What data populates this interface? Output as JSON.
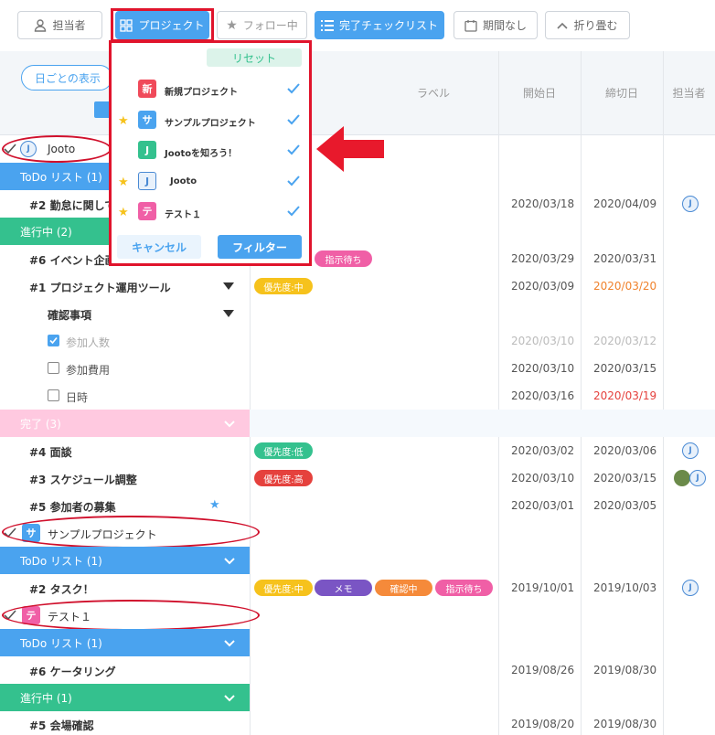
{
  "toolbar": {
    "assignee": "担当者",
    "project": "プロジェクト",
    "following": "フォロー中",
    "checklist": "完了チェックリスト",
    "no_deadline": "期間なし",
    "collapse": "折り畳む"
  },
  "left_header": {
    "view_by_day": "日ごとの表示"
  },
  "columns": {
    "label": "ラベル",
    "start": "開始日",
    "end": "締切日",
    "assignee": "担当者"
  },
  "dropdown": {
    "reset": "リセット",
    "cancel": "キャンセル",
    "filter": "フィルター",
    "items": [
      {
        "badge": "新",
        "name": "新規プロジェクト",
        "star": false
      },
      {
        "badge": "サ",
        "name": "サンプルプロジェクト",
        "star": true
      },
      {
        "badge": "J",
        "name": "Jootoを知ろう！",
        "star": false
      },
      {
        "badge": "J",
        "name": "Jooto",
        "star": true
      },
      {
        "badge": "テ",
        "name": "テスト１",
        "star": true
      }
    ]
  },
  "rows": {
    "proj_jooto": "Jooto",
    "todo1": "ToDo リスト (1)",
    "task_2a": "#2 勤怠に関して",
    "task_2a_start": "2020/03/18",
    "task_2a_end": "2020/04/09",
    "inprog": "進行中 (2)",
    "task_6": "#6 イベント企画",
    "task_6_tag": "指示待ち",
    "task_6_start": "2020/03/29",
    "task_6_end": "2020/03/31",
    "task_1": "#1 プロジェクト運用ツール",
    "task_1_tag": "優先度:中",
    "task_1_start": "2020/03/09",
    "task_1_end": "2020/03/20",
    "confirm": "確認事項",
    "sub_people": "参加人数",
    "sub_people_start": "2020/03/10",
    "sub_people_end": "2020/03/12",
    "sub_cost": "参加費用",
    "sub_cost_start": "2020/03/10",
    "sub_cost_end": "2020/03/15",
    "sub_date": "日時",
    "sub_date_start": "2020/03/16",
    "sub_date_end": "2020/03/19",
    "done": "完了 (3)",
    "task_4": "#4 面談",
    "task_4_tag": "優先度:低",
    "task_4_start": "2020/03/02",
    "task_4_end": "2020/03/06",
    "task_3": "#3 スケジュール調整",
    "task_3_tag": "優先度:高",
    "task_3_start": "2020/03/10",
    "task_3_end": "2020/03/15",
    "task_5": "#5 参加者の募集",
    "task_5_start": "2020/03/01",
    "task_5_end": "2020/03/05",
    "proj_sample": "サンプルプロジェクト",
    "todo2": "ToDo リスト (1)",
    "task_2b": "#2 タスク！",
    "task_2b_tags": [
      "優先度:中",
      "メモ",
      "確認中",
      "指示待ち"
    ],
    "task_2b_start": "2019/10/01",
    "task_2b_end": "2019/10/03",
    "proj_test": "テスト１",
    "todo3": "ToDo リスト (1)",
    "task_6b": "#6 ケータリング",
    "task_6b_start": "2019/08/26",
    "task_6b_end": "2019/08/30",
    "inprog2": "進行中 (1)",
    "task_5b": "#5 会場確認",
    "task_5b_start": "2019/08/20",
    "task_5b_end": "2019/08/30"
  },
  "colors": {
    "todo": "#4aa3ef",
    "in_progress": "#34c18e",
    "done": "#ffc9e0",
    "overdue": "#e5413d",
    "warning": "#f0822c"
  }
}
